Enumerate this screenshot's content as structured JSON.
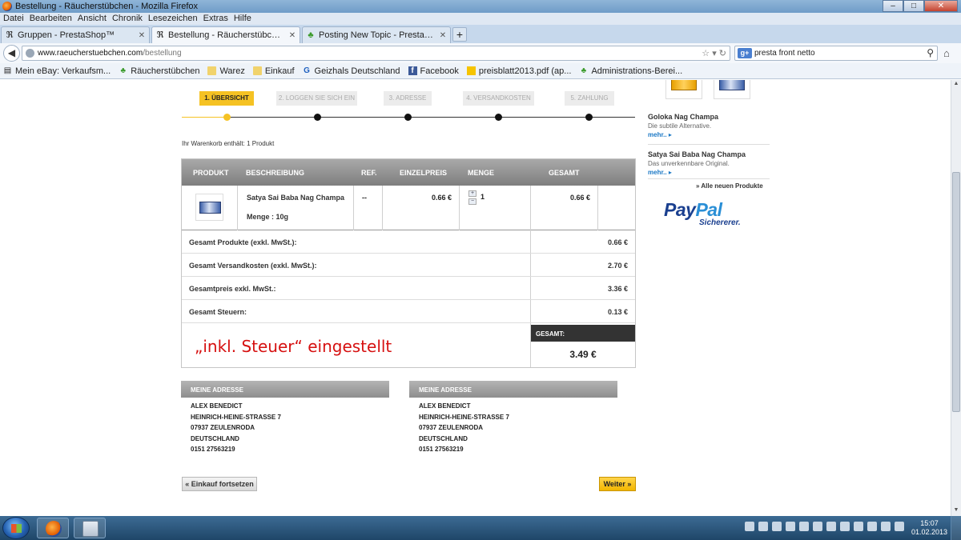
{
  "window": {
    "title": "Bestellung - Räucherstübchen - Mozilla Firefox",
    "controls": {
      "minimize": "–",
      "maximize": "□",
      "close": "✕"
    }
  },
  "menu": [
    "Datei",
    "Bearbeiten",
    "Ansicht",
    "Chronik",
    "Lesezeichen",
    "Extras",
    "Hilfe"
  ],
  "tabs": [
    {
      "label": "Gruppen - PrestaShop™",
      "icon": "prestashop-icon",
      "glyph": "ℜ"
    },
    {
      "label": "Bestellung - Räucherstübchen",
      "icon": "prestashop-icon",
      "glyph": "ℜ"
    },
    {
      "label": "Posting New Topic - PrestaShop Foru...",
      "icon": "leaf-icon",
      "glyph": "♣"
    }
  ],
  "address_bar": {
    "domain": "www.raeucherstuebchen.com",
    "path": "/bestellung"
  },
  "search_bar": {
    "engine_badge": "g+",
    "query": "presta front netto"
  },
  "bookmarks": [
    {
      "label": "Mein eBay: Verkaufsm...",
      "icon": "ebay-icon"
    },
    {
      "label": "Räucherstübchen",
      "icon": "leaf-icon"
    },
    {
      "label": "Warez",
      "icon": "folder-icon"
    },
    {
      "label": "Einkauf",
      "icon": "folder-icon"
    },
    {
      "label": "Geizhals Deutschland",
      "icon": "geizhals-icon"
    },
    {
      "label": "Facebook",
      "icon": "facebook-icon"
    },
    {
      "label": "preisblatt2013.pdf (ap...",
      "icon": "post-icon"
    },
    {
      "label": "Administrations-Berei...",
      "icon": "leaf-icon"
    }
  ],
  "steps": [
    "1. ÜBERSICHT",
    "2. LOGGEN SIE SICH EIN",
    "3. ADRESSE",
    "4. VERSANDKOSTEN",
    "5. ZAHLUNG"
  ],
  "cart_count": "Ihr Warenkorb enthält: 1 Produkt",
  "table": {
    "headers": {
      "product": "PRODUKT",
      "description": "BESCHREIBUNG",
      "ref": "REF.",
      "unit_price": "EINZELPREIS",
      "quantity": "MENGE",
      "total": "GESAMT"
    },
    "row": {
      "name": "Satya Sai Baba Nag Champa",
      "variant": "Menge : 10g",
      "ref": "--",
      "unit_price": "0.66 €",
      "quantity": "1",
      "total": "0.66 €"
    },
    "summary": [
      {
        "label": "Gesamt Produkte (exkl. MwSt.):",
        "value": "0.66 €"
      },
      {
        "label": "Gesamt Versandkosten (exkl. MwSt.):",
        "value": "2.70 €"
      },
      {
        "label": "Gesamtpreis exkl. MwSt.:",
        "value": "3.36 €"
      },
      {
        "label": "Gesamt Steuern:",
        "value": "0.13 €"
      }
    ],
    "grand_total_label": "GESAMT:",
    "grand_total": "3.49 €",
    "annotation": "„inkl. Steuer“ eingestellt"
  },
  "addresses": [
    {
      "heading": "MEINE ADRESSE",
      "lines": [
        "ALEX BENEDICT",
        "HEINRICH-HEINE-STRASSE 7",
        "07937 ZEULENRODA",
        "DEUTSCHLAND",
        "0151 27563219"
      ]
    },
    {
      "heading": "MEINE ADRESSE",
      "lines": [
        "ALEX BENEDICT",
        "HEINRICH-HEINE-STRASSE 7",
        "07937 ZEULENRODA",
        "DEUTSCHLAND",
        "0151 27563219"
      ]
    }
  ],
  "buttons": {
    "back": "« Einkauf fortsetzen",
    "next": "Weiter »"
  },
  "sidebar": {
    "products": [
      {
        "name": "Goloka Nag Champa",
        "desc": "Die subtile Alternative.",
        "more": "mehr.."
      },
      {
        "name": "Satya Sai Baba Nag Champa",
        "desc": "Das unverkennbare Original.",
        "more": "mehr.."
      }
    ],
    "all_new": "» Alle neuen Produkte",
    "paypal": {
      "pay": "Pay",
      "pal": "Pal",
      "tagline": "Sichererer."
    }
  },
  "clock": {
    "time": "15:07",
    "date": "01.02.2013"
  },
  "colors": {
    "accent": "#f5c223",
    "annotation": "#d61010",
    "link": "#1b78c5"
  }
}
